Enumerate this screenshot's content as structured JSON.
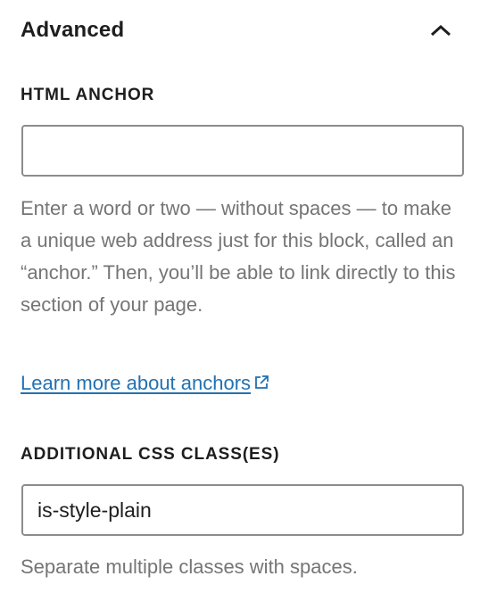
{
  "panel": {
    "title": "Advanced",
    "toggle_icon": "chevron-up-icon"
  },
  "anchor_field": {
    "label": "HTML ANCHOR",
    "value": "",
    "help": "Enter a word or two — without spaces — to make a unique web address just for this block, called an “anchor.” Then, you’ll be able to link directly to this section of your page.",
    "link_text": "Learn more about anchors",
    "link_icon": "external-link-icon"
  },
  "css_field": {
    "label": "ADDITIONAL CSS CLASS(ES)",
    "value": "is-style-plain",
    "help": "Separate multiple classes with spaces."
  },
  "colors": {
    "text": "#1e1e1e",
    "help_text": "#757575",
    "link": "#2271b1",
    "input_border": "#8c8c8c"
  }
}
